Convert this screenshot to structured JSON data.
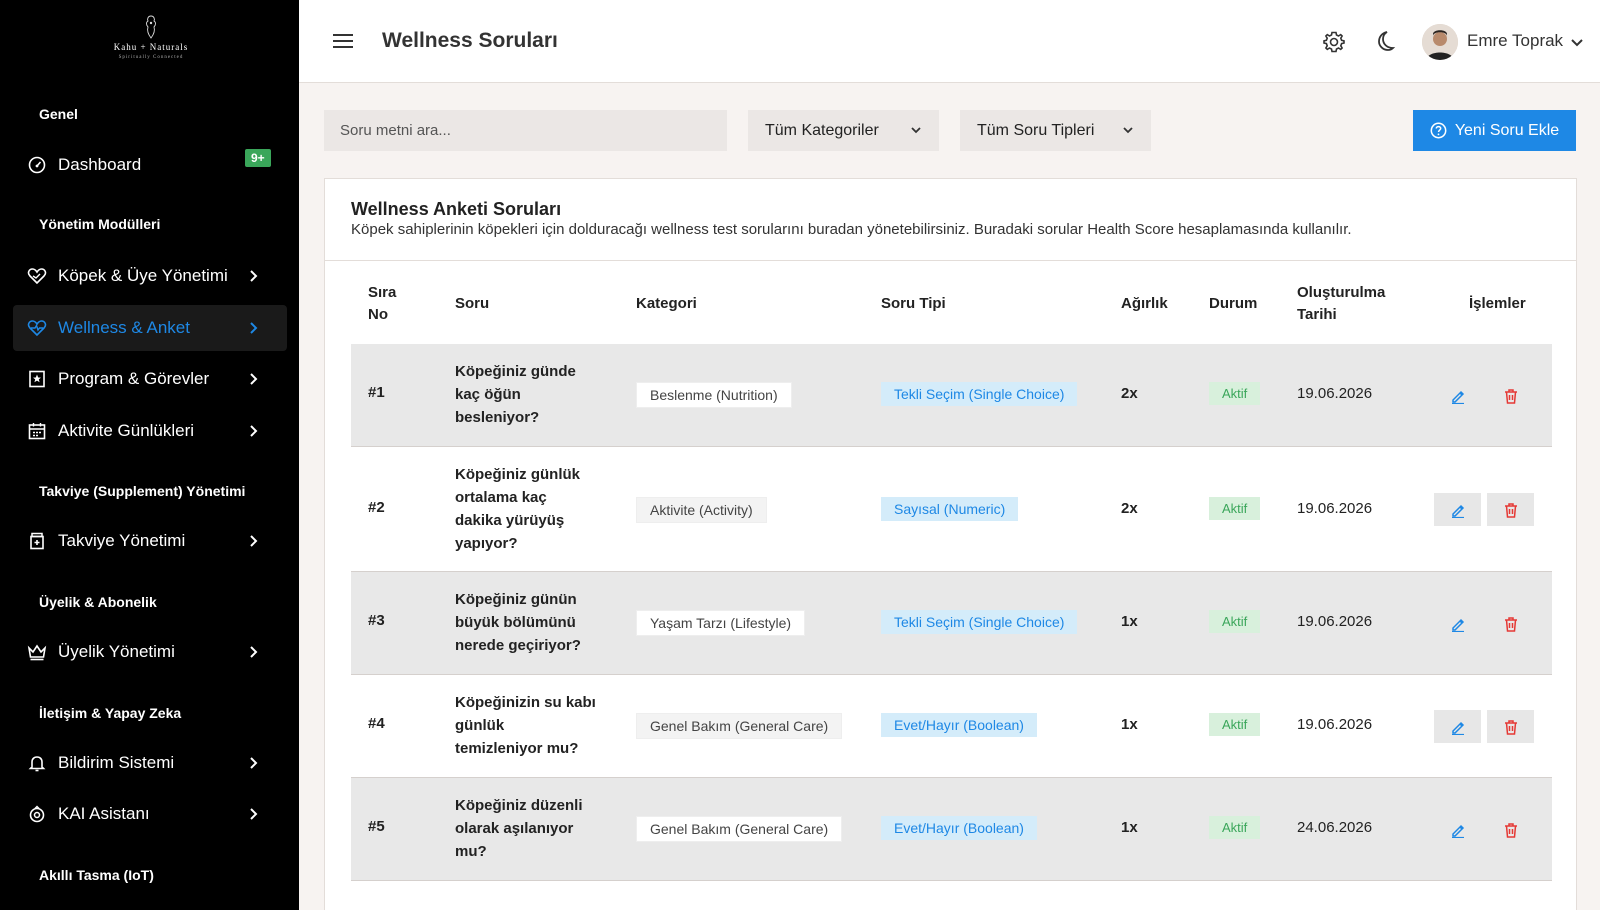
{
  "brand": {
    "name": "Kahu + Naturals",
    "tagline": "Spiritually Connected"
  },
  "sidebar": {
    "sections": [
      {
        "title": "Genel"
      },
      {
        "title": "Yönetim Modülleri"
      },
      {
        "title": "Takviye (Supplement) Yönetimi"
      },
      {
        "title": "Üyelik & Abonelik"
      },
      {
        "title": "İletişim & Yapay Zeka"
      },
      {
        "title": "Akıllı Tasma (IoT)"
      }
    ],
    "items": [
      {
        "label": "Dashboard",
        "icon": "gauge-icon",
        "badge": "9+"
      },
      {
        "label": "Köpek & Üye Yönetimi",
        "icon": "heart-hand-icon"
      },
      {
        "label": "Wellness & Anket",
        "icon": "heart-pulse-icon",
        "active": true
      },
      {
        "label": "Program & Görevler",
        "icon": "bookmark-star-icon"
      },
      {
        "label": "Aktivite Günlükleri",
        "icon": "calendar-icon"
      },
      {
        "label": "Takviye Yönetimi",
        "icon": "pill-bottle-icon"
      },
      {
        "label": "Üyelik Yönetimi",
        "icon": "crown-icon"
      },
      {
        "label": "Bildirim Sistemi",
        "icon": "bell-icon"
      },
      {
        "label": "KAI Asistanı",
        "icon": "robot-icon"
      }
    ]
  },
  "header": {
    "title": "Wellness Soruları",
    "user_name": "Emre Toprak"
  },
  "filters": {
    "search_placeholder": "Soru metni ara...",
    "category": "Tüm Kategoriler",
    "type": "Tüm Soru Tipleri",
    "add_button": "Yeni Soru Ekle"
  },
  "card": {
    "title": "Wellness Anketi Soruları",
    "description": "Köpek sahiplerinin köpekleri için dolduracağı wellness test sorularını buradan yönetebilirsiniz. Buradaki sorular Health Score hesaplamasında kullanılır."
  },
  "table": {
    "headers": {
      "no_1": "Sıra",
      "no_2": "No",
      "question": "Soru",
      "category": "Kategori",
      "type": "Soru Tipi",
      "weight": "Ağırlık",
      "status": "Durum",
      "created_1": "Oluşturulma",
      "created_2": "Tarihi",
      "actions": "İşlemler"
    },
    "rows": [
      {
        "no": "#1",
        "q": [
          "Köpeğiniz günde",
          "kaç öğün",
          "besleniyor?"
        ],
        "category": "Beslenme (Nutrition)",
        "type": "Tekli Seçim (Single Choice)",
        "weight": "2x",
        "status": "Aktif",
        "date": "19.06.2026"
      },
      {
        "no": "#2",
        "q": [
          "Köpeğiniz günlük",
          "ortalama kaç",
          "dakika yürüyüş",
          "yapıyor?"
        ],
        "category": "Aktivite (Activity)",
        "type": "Sayısal (Numeric)",
        "weight": "2x",
        "status": "Aktif",
        "date": "19.06.2026"
      },
      {
        "no": "#3",
        "q": [
          "Köpeğiniz günün",
          "büyük bölümünü",
          "nerede geçiriyor?"
        ],
        "category": "Yaşam Tarzı (Lifestyle)",
        "type": "Tekli Seçim (Single Choice)",
        "weight": "1x",
        "status": "Aktif",
        "date": "19.06.2026"
      },
      {
        "no": "#4",
        "q": [
          "Köpeğinizin su kabı",
          "günlük",
          "temizleniyor mu?"
        ],
        "category": "Genel Bakım (General Care)",
        "type": "Evet/Hayır (Boolean)",
        "weight": "1x",
        "status": "Aktif",
        "date": "19.06.2026"
      },
      {
        "no": "#5",
        "q": [
          "Köpeğiniz düzenli",
          "olarak aşılanıyor",
          "mu?"
        ],
        "category": "Genel Bakım (General Care)",
        "type": "Evet/Hayır (Boolean)",
        "weight": "1x",
        "status": "Aktif",
        "date": "24.06.2026"
      }
    ]
  },
  "colors": {
    "accent": "#1e88e5",
    "success": "#3aa65a",
    "danger": "#e53935",
    "sidebar_bg": "#000000"
  }
}
